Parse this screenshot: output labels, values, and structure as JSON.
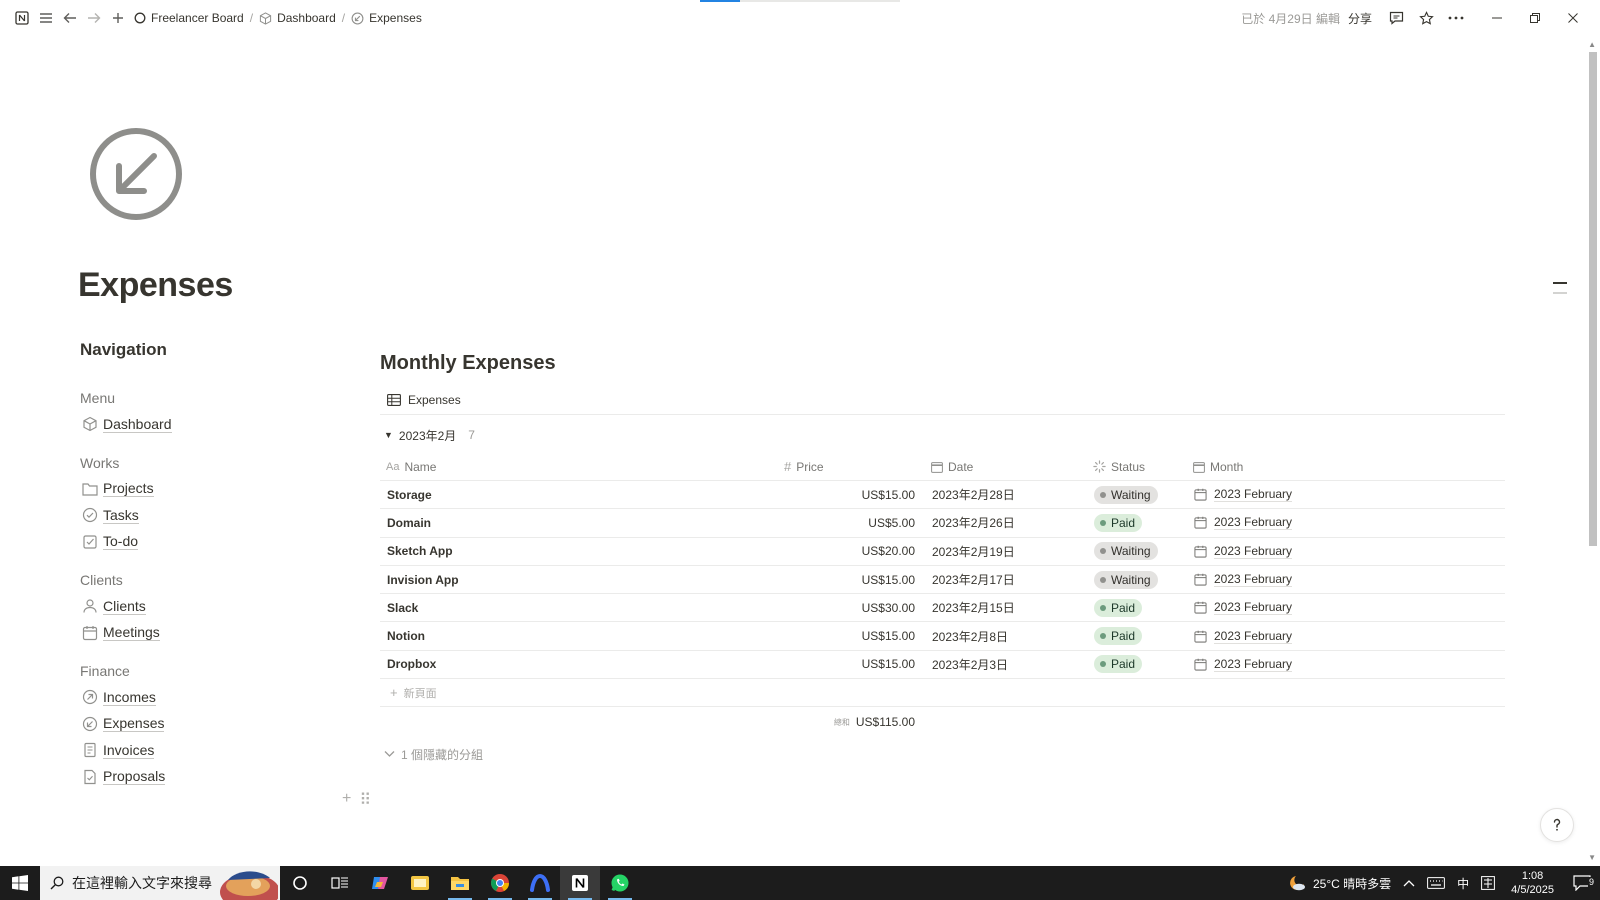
{
  "topbar": {
    "breadcrumbs": [
      "Freelancer Board",
      "Dashboard",
      "Expenses"
    ],
    "edited": "已於 4月29日 編輯",
    "share": "分享"
  },
  "page": {
    "title": "Expenses"
  },
  "nav": {
    "title": "Navigation",
    "groups": [
      {
        "label": "Menu",
        "items": [
          "Dashboard"
        ]
      },
      {
        "label": "Works",
        "items": [
          "Projects",
          "Tasks",
          "To-do"
        ]
      },
      {
        "label": "Clients",
        "items": [
          "Clients",
          "Meetings"
        ]
      },
      {
        "label": "Finance",
        "items": [
          "Incomes",
          "Expenses",
          "Invoices",
          "Proposals"
        ]
      }
    ]
  },
  "database": {
    "title": "Monthly Expenses",
    "view": "Expenses",
    "group": {
      "label": "2023年2月",
      "count": "7"
    },
    "columns": [
      "Name",
      "Price",
      "Date",
      "Status",
      "Month"
    ],
    "rows": [
      {
        "name": "Storage",
        "price": "US$15.00",
        "date": "2023年2月28日",
        "status": "Waiting",
        "month": "2023 February"
      },
      {
        "name": "Domain",
        "price": "US$5.00",
        "date": "2023年2月26日",
        "status": "Paid",
        "month": "2023 February"
      },
      {
        "name": "Sketch App",
        "price": "US$20.00",
        "date": "2023年2月19日",
        "status": "Waiting",
        "month": "2023 February"
      },
      {
        "name": "Invision App",
        "price": "US$15.00",
        "date": "2023年2月17日",
        "status": "Waiting",
        "month": "2023 February"
      },
      {
        "name": "Slack",
        "price": "US$30.00",
        "date": "2023年2月15日",
        "status": "Paid",
        "month": "2023 February"
      },
      {
        "name": "Notion",
        "price": "US$15.00",
        "date": "2023年2月8日",
        "status": "Paid",
        "month": "2023 February"
      },
      {
        "name": "Dropbox",
        "price": "US$15.00",
        "date": "2023年2月3日",
        "status": "Paid",
        "month": "2023 February"
      }
    ],
    "new_page": "新頁面",
    "sum_label": "總和",
    "sum_value": "US$115.00",
    "hidden_groups": "1 個隱藏的分組"
  },
  "taskbar": {
    "search_placeholder": "在這裡輸入文字來搜尋",
    "weather": "25°C 晴時多雲",
    "ime": "中",
    "time": "1:08",
    "date": "4/5/2025",
    "notifications": "9"
  },
  "colors": {
    "waiting_bg": "#e3e2e0",
    "paid_bg": "#dbeddb",
    "accent": "#2383e2"
  }
}
